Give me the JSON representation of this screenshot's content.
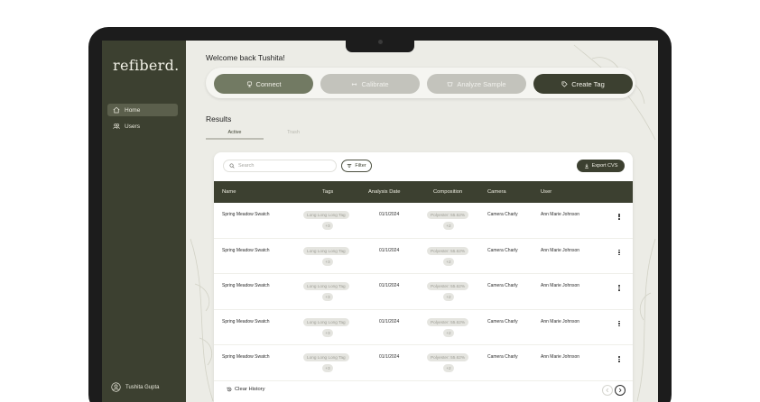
{
  "sidebar": {
    "logo": "refiberd.",
    "items": [
      {
        "label": "Home",
        "icon": "home-icon"
      },
      {
        "label": "Users",
        "icon": "users-icon"
      }
    ],
    "user_name": "Tushita Gupta"
  },
  "header": {
    "welcome": "Welcome back Tushita!"
  },
  "actions": {
    "connect": "Connect",
    "calibrate": "Calibrate",
    "analyze": "Analyze Sample",
    "create_tag": "Create Tag"
  },
  "results": {
    "title": "Results",
    "tabs": [
      {
        "label": "Active"
      },
      {
        "label": "Trash"
      }
    ],
    "search_placeholder": "Search",
    "filter_label": "Filter",
    "export_label": "Export CVS",
    "columns": {
      "name": "Name",
      "tags": "Tags",
      "analysis_date": "Analysis Date",
      "composition": "Composition",
      "camera": "Camera",
      "user": "User"
    },
    "rows": [
      {
        "name": "Spring Meadow Swatch",
        "tag": "Long Long Long Tag",
        "tag_more": "+3",
        "date": "01/1/2024",
        "composition": "Polyester: 55.62%",
        "composition_more": "+2",
        "camera": "Camera Charly",
        "user": "Ann Marie Johnson"
      },
      {
        "name": "Spring Meadow Swatch",
        "tag": "Long Long Long Tag",
        "tag_more": "+3",
        "date": "01/1/2024",
        "composition": "Polyester: 55.62%",
        "composition_more": "+2",
        "camera": "Camera Charly",
        "user": "Ann Marie Johnson"
      },
      {
        "name": "Spring Meadow Swatch",
        "tag": "Long Long Long Tag",
        "tag_more": "+3",
        "date": "01/1/2024",
        "composition": "Polyester: 55.62%",
        "composition_more": "+2",
        "camera": "Camera Charly",
        "user": "Ann Marie Johnson"
      },
      {
        "name": "Spring Meadow Swatch",
        "tag": "Long Long Long Tag",
        "tag_more": "+3",
        "date": "01/1/2024",
        "composition": "Polyester: 55.62%",
        "composition_more": "+2",
        "camera": "Camera Charly",
        "user": "Ann Marie Johnson"
      },
      {
        "name": "Spring Meadow Swatch",
        "tag": "Long Long Long Tag",
        "tag_more": "+3",
        "date": "01/1/2024",
        "composition": "Polyester: 55.62%",
        "composition_more": "+2",
        "camera": "Camera Charly",
        "user": "Ann Marie Johnson"
      }
    ],
    "clear_history": "Clear History"
  },
  "colors": {
    "brand_dark": "#3c4030",
    "brand_mid": "#727a63",
    "disabled": "#c3c3bc",
    "background": "#ecece6"
  }
}
